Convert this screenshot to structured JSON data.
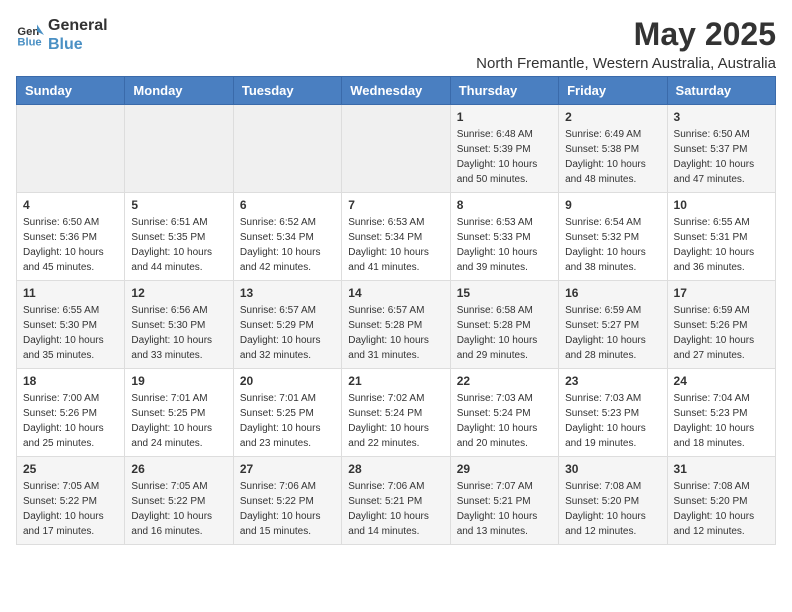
{
  "logo": {
    "general": "General",
    "blue": "Blue"
  },
  "title": "May 2025",
  "subtitle": "North Fremantle, Western Australia, Australia",
  "weekdays": [
    "Sunday",
    "Monday",
    "Tuesday",
    "Wednesday",
    "Thursday",
    "Friday",
    "Saturday"
  ],
  "weeks": [
    [
      {
        "day": "",
        "info": ""
      },
      {
        "day": "",
        "info": ""
      },
      {
        "day": "",
        "info": ""
      },
      {
        "day": "",
        "info": ""
      },
      {
        "day": "1",
        "info": "Sunrise: 6:48 AM\nSunset: 5:39 PM\nDaylight: 10 hours\nand 50 minutes."
      },
      {
        "day": "2",
        "info": "Sunrise: 6:49 AM\nSunset: 5:38 PM\nDaylight: 10 hours\nand 48 minutes."
      },
      {
        "day": "3",
        "info": "Sunrise: 6:50 AM\nSunset: 5:37 PM\nDaylight: 10 hours\nand 47 minutes."
      }
    ],
    [
      {
        "day": "4",
        "info": "Sunrise: 6:50 AM\nSunset: 5:36 PM\nDaylight: 10 hours\nand 45 minutes."
      },
      {
        "day": "5",
        "info": "Sunrise: 6:51 AM\nSunset: 5:35 PM\nDaylight: 10 hours\nand 44 minutes."
      },
      {
        "day": "6",
        "info": "Sunrise: 6:52 AM\nSunset: 5:34 PM\nDaylight: 10 hours\nand 42 minutes."
      },
      {
        "day": "7",
        "info": "Sunrise: 6:53 AM\nSunset: 5:34 PM\nDaylight: 10 hours\nand 41 minutes."
      },
      {
        "day": "8",
        "info": "Sunrise: 6:53 AM\nSunset: 5:33 PM\nDaylight: 10 hours\nand 39 minutes."
      },
      {
        "day": "9",
        "info": "Sunrise: 6:54 AM\nSunset: 5:32 PM\nDaylight: 10 hours\nand 38 minutes."
      },
      {
        "day": "10",
        "info": "Sunrise: 6:55 AM\nSunset: 5:31 PM\nDaylight: 10 hours\nand 36 minutes."
      }
    ],
    [
      {
        "day": "11",
        "info": "Sunrise: 6:55 AM\nSunset: 5:30 PM\nDaylight: 10 hours\nand 35 minutes."
      },
      {
        "day": "12",
        "info": "Sunrise: 6:56 AM\nSunset: 5:30 PM\nDaylight: 10 hours\nand 33 minutes."
      },
      {
        "day": "13",
        "info": "Sunrise: 6:57 AM\nSunset: 5:29 PM\nDaylight: 10 hours\nand 32 minutes."
      },
      {
        "day": "14",
        "info": "Sunrise: 6:57 AM\nSunset: 5:28 PM\nDaylight: 10 hours\nand 31 minutes."
      },
      {
        "day": "15",
        "info": "Sunrise: 6:58 AM\nSunset: 5:28 PM\nDaylight: 10 hours\nand 29 minutes."
      },
      {
        "day": "16",
        "info": "Sunrise: 6:59 AM\nSunset: 5:27 PM\nDaylight: 10 hours\nand 28 minutes."
      },
      {
        "day": "17",
        "info": "Sunrise: 6:59 AM\nSunset: 5:26 PM\nDaylight: 10 hours\nand 27 minutes."
      }
    ],
    [
      {
        "day": "18",
        "info": "Sunrise: 7:00 AM\nSunset: 5:26 PM\nDaylight: 10 hours\nand 25 minutes."
      },
      {
        "day": "19",
        "info": "Sunrise: 7:01 AM\nSunset: 5:25 PM\nDaylight: 10 hours\nand 24 minutes."
      },
      {
        "day": "20",
        "info": "Sunrise: 7:01 AM\nSunset: 5:25 PM\nDaylight: 10 hours\nand 23 minutes."
      },
      {
        "day": "21",
        "info": "Sunrise: 7:02 AM\nSunset: 5:24 PM\nDaylight: 10 hours\nand 22 minutes."
      },
      {
        "day": "22",
        "info": "Sunrise: 7:03 AM\nSunset: 5:24 PM\nDaylight: 10 hours\nand 20 minutes."
      },
      {
        "day": "23",
        "info": "Sunrise: 7:03 AM\nSunset: 5:23 PM\nDaylight: 10 hours\nand 19 minutes."
      },
      {
        "day": "24",
        "info": "Sunrise: 7:04 AM\nSunset: 5:23 PM\nDaylight: 10 hours\nand 18 minutes."
      }
    ],
    [
      {
        "day": "25",
        "info": "Sunrise: 7:05 AM\nSunset: 5:22 PM\nDaylight: 10 hours\nand 17 minutes."
      },
      {
        "day": "26",
        "info": "Sunrise: 7:05 AM\nSunset: 5:22 PM\nDaylight: 10 hours\nand 16 minutes."
      },
      {
        "day": "27",
        "info": "Sunrise: 7:06 AM\nSunset: 5:22 PM\nDaylight: 10 hours\nand 15 minutes."
      },
      {
        "day": "28",
        "info": "Sunrise: 7:06 AM\nSunset: 5:21 PM\nDaylight: 10 hours\nand 14 minutes."
      },
      {
        "day": "29",
        "info": "Sunrise: 7:07 AM\nSunset: 5:21 PM\nDaylight: 10 hours\nand 13 minutes."
      },
      {
        "day": "30",
        "info": "Sunrise: 7:08 AM\nSunset: 5:20 PM\nDaylight: 10 hours\nand 12 minutes."
      },
      {
        "day": "31",
        "info": "Sunrise: 7:08 AM\nSunset: 5:20 PM\nDaylight: 10 hours\nand 12 minutes."
      }
    ]
  ]
}
